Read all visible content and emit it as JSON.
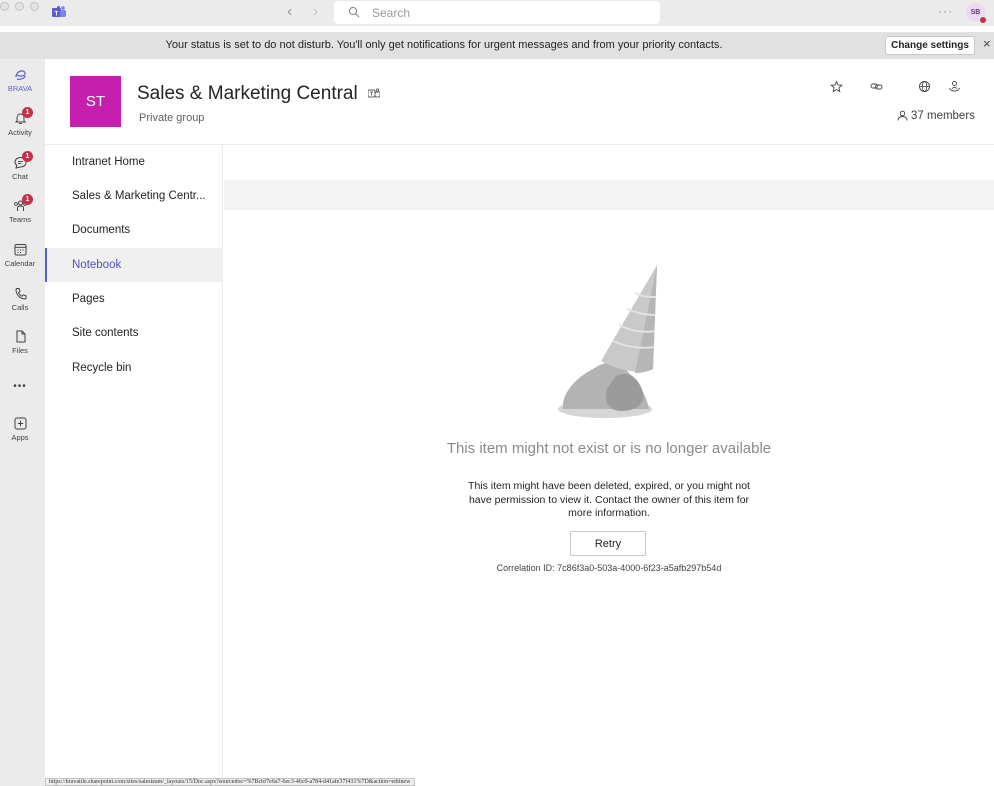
{
  "titlebar": {
    "back_icon": "chevron-left-icon",
    "forward_icon": "chevron-right-icon",
    "search_placeholder": "Search",
    "more_label": "···",
    "avatar_initials": "SB"
  },
  "banner": {
    "message": "Your status is set to do not disturb. You'll only get notifications for urgent messages and from your priority contacts.",
    "button_label": "Change settings",
    "close_icon": "×"
  },
  "rail": {
    "items": [
      {
        "label": "BRAVA",
        "icon": "brava-icon",
        "badge": ""
      },
      {
        "label": "Activity",
        "icon": "bell-icon",
        "badge": "1"
      },
      {
        "label": "Chat",
        "icon": "chat-icon",
        "badge": "1"
      },
      {
        "label": "Teams",
        "icon": "teams-icon",
        "badge": "1"
      },
      {
        "label": "Calendar",
        "icon": "calendar-icon",
        "badge": ""
      },
      {
        "label": "Calls",
        "icon": "phone-icon",
        "badge": ""
      },
      {
        "label": "Files",
        "icon": "file-icon",
        "badge": ""
      },
      {
        "label": "•••",
        "icon": "more-icon",
        "badge": ""
      },
      {
        "label": "Apps",
        "icon": "apps-icon",
        "badge": ""
      }
    ]
  },
  "site": {
    "logo_initials": "ST",
    "title": "Sales & Marketing Central",
    "subtitle": "Private group",
    "members": "37 members",
    "logo_color": "#c41fae"
  },
  "nav": {
    "items": [
      {
        "label": "Intranet Home"
      },
      {
        "label": "Sales & Marketing Centr..."
      },
      {
        "label": "Documents"
      },
      {
        "label": "Notebook"
      },
      {
        "label": "Pages"
      },
      {
        "label": "Site contents"
      },
      {
        "label": "Recycle bin"
      }
    ],
    "active": "Notebook",
    "accent": "#5b5fc7"
  },
  "error": {
    "title": "This item might not exist or is no longer available",
    "description": "This item might have been deleted, expired, or you might not have permission to view it. Contact the owner of this item for more information.",
    "retry_label": "Retry",
    "correlation": "Correlation ID: 7c86f3a0-503a-4000-6f23-a5afb297b54d"
  },
  "statusbar": {
    "url": "https://bravatile.sharepoint.com/sites/salesteam/_layouts/15/Doc.aspx?sourcedoc=%7Bcbf7e6a7-6ec3-46c0-a784-d41afe37f431%7D&action=editnew"
  }
}
